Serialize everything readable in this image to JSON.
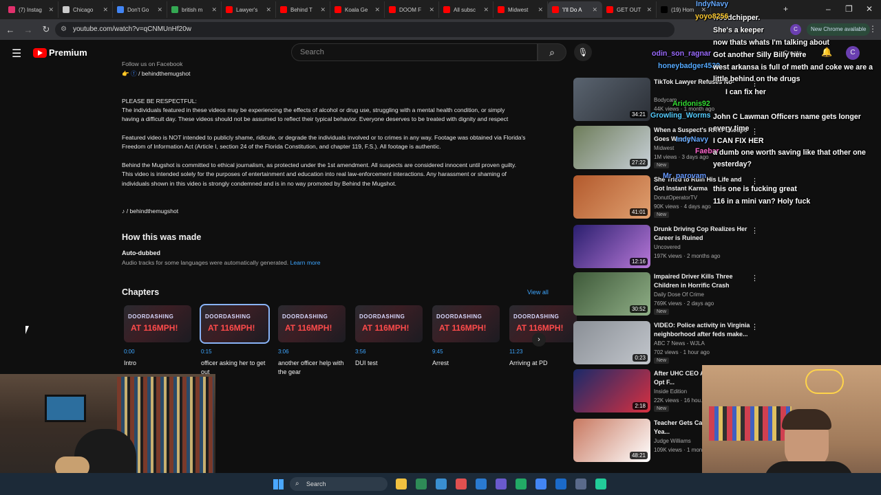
{
  "browser": {
    "tabs": [
      {
        "label": "(7) Instag",
        "color": "#e1306c"
      },
      {
        "label": "Chicago",
        "color": "#cccccc"
      },
      {
        "label": "Don't Go",
        "color": "#4285f4"
      },
      {
        "label": "british m",
        "color": "#34a853"
      },
      {
        "label": "Lawyer's",
        "color": "#ff0000"
      },
      {
        "label": "Behind T",
        "color": "#ff0000"
      },
      {
        "label": "Koala Ge",
        "color": "#ff0000"
      },
      {
        "label": "DOOM F",
        "color": "#ff0000"
      },
      {
        "label": "All subsc",
        "color": "#ff0000"
      },
      {
        "label": "Midwest",
        "color": "#ff0000"
      },
      {
        "label": "'I'll Do A",
        "color": "#ff0000"
      },
      {
        "label": "GET OUT",
        "color": "#ff0000"
      },
      {
        "label": "(19) Hom",
        "color": "#000000"
      }
    ],
    "url": "youtube.com/watch?v=qCNMUnHf20w",
    "new_chrome": "New Chrome available",
    "profile_initial": "C"
  },
  "youtube": {
    "logo": "Premium",
    "search_placeholder": "Search",
    "create_label": "Create",
    "avatar": "C"
  },
  "description": {
    "fb_partial": "Follow us on Facebook",
    "fb_link": "/ behindthemugshot",
    "respect_heading": "PLEASE BE RESPECTFUL:",
    "respect_1": "The individuals featured in these videos may be experiencing the effects of alcohol or drug use, struggling with a mental health condition, or simply",
    "respect_2": "having a difficult day. These videos should not be assumed to reflect their typical behavior. Everyone deserves to be treated with dignity and respect",
    "feat_1": "Featured video is NOT intended to publicly shame, ridicule, or degrade the individuals involved or to crimes in any way. Footage was obtained via Florida's",
    "feat_2": "Freedom of Information Act (Article I, section 24 of the Florida Constitution, and chapter 119, F.S.). All footage is authentic.",
    "btm_1": "Behind the Mugshot is committed to ethical journalism, as protected under the 1st amendment. All suspects are considered innocent until proven guilty.",
    "btm_2": "This video is intended solely for the purposes of entertainment and education into real law-enforcement interactions. Any harassment or shaming of",
    "btm_3": "individuals shown in this video is strongly condemned and is in no way promoted by Behind the Mugshot.",
    "tiktok_link": "/ behindthemugshot",
    "how_made": "How this was made",
    "auto_dubbed": "Auto-dubbed",
    "auto_desc": "Audio tracks for some languages were automatically generated.",
    "learn_more": "Learn more",
    "chapters_heading": "Chapters",
    "view_all": "View all",
    "chapters": [
      {
        "time": "0:00",
        "title": "Intro"
      },
      {
        "time": "0:15",
        "title": "officer asking her to get out"
      },
      {
        "time": "3:06",
        "title": "another officer help with the gear"
      },
      {
        "time": "3:56",
        "title": "DUI test"
      },
      {
        "time": "9:45",
        "title": "Arrest"
      },
      {
        "time": "11:23",
        "title": "Arriving at PD"
      }
    ],
    "thumb_text_1": "DOORDASHING",
    "thumb_text_2": "AT 116MPH!"
  },
  "related": [
    {
      "title": "TikTok Lawyer Refuses No-",
      "channel": "Bodycam",
      "meta": "44K views · 1 month ago",
      "dur": "34:21",
      "new": false,
      "c1": "#5a6470",
      "c2": "#2b2f36"
    },
    {
      "title": "When a Suspect's River Escape Goes Wrong",
      "channel": "Midwest",
      "meta": "1M views · 3 days ago",
      "dur": "27:22",
      "new": true,
      "c1": "#6e7d5a",
      "c2": "#c8d0d8"
    },
    {
      "title": "She Tried to Ruin His Life and Got Instant Karma",
      "channel": "DonutOperatorTV",
      "meta": "90K views · 4 days ago",
      "dur": "41:01",
      "new": true,
      "c1": "#b35a2d",
      "c2": "#e0a070"
    },
    {
      "title": "Drunk Driving Cop Realizes Her Career is Ruined",
      "channel": "Uncovered",
      "meta": "197K views · 2 months ago",
      "dur": "12:16",
      "new": false,
      "c1": "#2a1f6e",
      "c2": "#b878d8"
    },
    {
      "title": "Impaired Driver Kills Three Children in Horrific Crash",
      "channel": "Daily Dose Of Crime",
      "meta": "769K views · 2 days ago",
      "dur": "30:52",
      "new": true,
      "c1": "#3f5a3a",
      "c2": "#8fae86"
    },
    {
      "title": "VIDEO: Police activity in Virginia neighborhood after feds make...",
      "channel": "ABC 7 News - WJLA",
      "meta": "702 views · 1 hour ago",
      "dur": "0:23",
      "new": true,
      "c1": "#8a8f96",
      "c2": "#c2c6cc"
    },
    {
      "title": "After UHC CEO A... Executives Opt F...",
      "channel": "Inside Edition",
      "meta": "22K views · 16 hou...",
      "dur": "2:18",
      "new": true,
      "c1": "#1a2a6a",
      "c2": "#d83040"
    },
    {
      "title": "Teacher Gets Ca... S*X With 15-Yea...",
      "channel": "Judge Williams",
      "meta": "109K views · 1 mon...",
      "dur": "48:21",
      "new": false,
      "c1": "#c87860",
      "c2": "#ffffff"
    }
  ],
  "chat": [
    {
      "name": "IndyNavy",
      "text": "woodchipper.",
      "color": "#66aaff"
    },
    {
      "name": "yoyo8256",
      "text": "She's a keeper",
      "color": "#ffcc33"
    },
    {
      "name": "",
      "text": "now thats whats I'm talking about",
      "color": "#ffffff"
    },
    {
      "name": "odin_son_ragnar",
      "text": "Got another Silly Billy here",
      "color": "#9b6bff"
    },
    {
      "name": "honeybadger4539",
      "text": "west arkansa is full of meth and coke we are a little behind on the drugs",
      "color": "#55aaff"
    },
    {
      "name": "",
      "text": "I can fix her",
      "color": "#ffffff"
    },
    {
      "name": "Aridonis92",
      "text": "",
      "color": "#33dd33"
    },
    {
      "name": "Growling_Worms",
      "text": "John C Lawman Officers name gets longer every time",
      "color": "#55ccff"
    },
    {
      "name": "IndyNavy",
      "text": "I CAN FIX HER",
      "color": "#66aaff"
    },
    {
      "name": "Faebar",
      "text": "a dumb one worth saving like that other one yesterday?",
      "color": "#ff66cc"
    },
    {
      "name": "Mr_parovam",
      "text": "this one is fucking great",
      "color": "#6699ff"
    },
    {
      "name": "",
      "text": "116 in a mini van? Holy fuck",
      "color": "#ffffff"
    }
  ],
  "taskbar": {
    "search": "Search"
  }
}
